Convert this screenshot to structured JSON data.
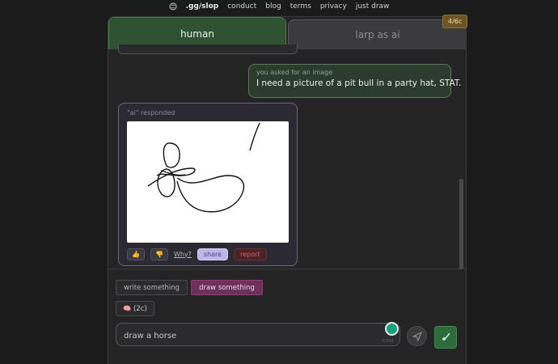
{
  "nav": {
    "logo_icon": "brain-icon",
    "brand": ".gg/slop",
    "links": [
      "conduct",
      "blog",
      "terms",
      "privacy",
      "just draw"
    ]
  },
  "credits_badge": "4/6c",
  "tabs": {
    "human": "human",
    "larp": "larp as ai"
  },
  "messages": {
    "user": {
      "label": "you asked for an image",
      "text": "I need a picture of a pit bull in a party hat, STAT."
    },
    "ai": {
      "label": "\"ai\" responded",
      "drawing_icon": "scribble-drawing",
      "actions": {
        "like_icon": "thumbs-up-icon",
        "dislike_icon": "thumbs-down-icon",
        "why": "Why?",
        "share": "share",
        "report": "report"
      }
    }
  },
  "modes": {
    "write": "write something",
    "draw": "draw something",
    "selected": "draw"
  },
  "cost": "(2c)",
  "prompt": {
    "value": "draw a horse",
    "char_count": "0/200"
  },
  "colors": {
    "human_tab": "#2f5232",
    "draw_mode": "#6d2f5c",
    "share": "#bfb6e8",
    "report": "#4a2326",
    "submit": "#2d6b3a"
  }
}
